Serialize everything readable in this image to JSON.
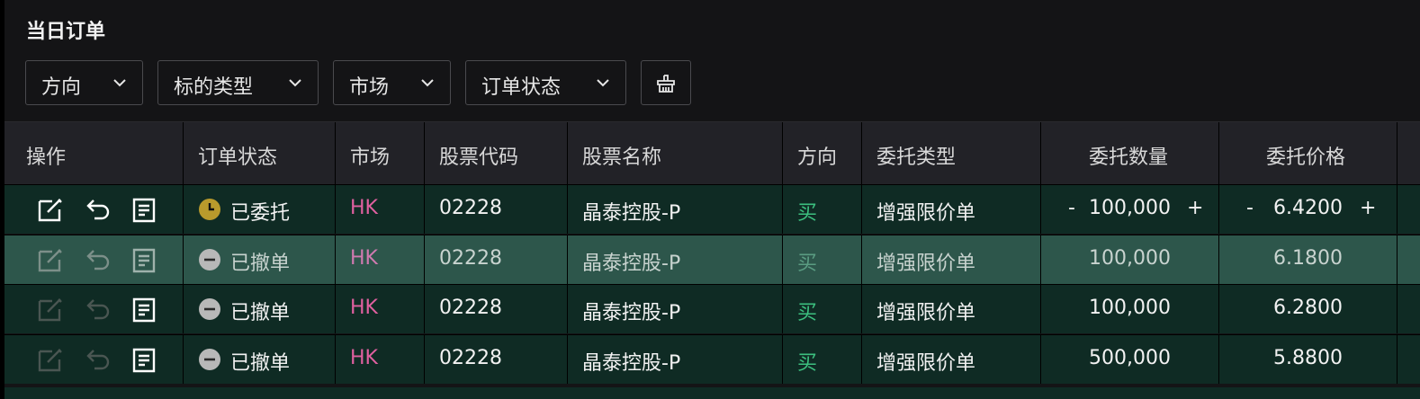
{
  "title": "当日订单",
  "filters": [
    {
      "label": "方向"
    },
    {
      "label": "标的类型"
    },
    {
      "label": "市场"
    },
    {
      "label": "订单状态"
    }
  ],
  "columns": [
    "操作",
    "订单状态",
    "市场",
    "股票代码",
    "股票名称",
    "方向",
    "委托类型",
    "委托数量",
    "委托价格"
  ],
  "rows": [
    {
      "status": "已委托",
      "status_kind": "pending",
      "market": "HK",
      "code": "02228",
      "name": "晶泰控股-P",
      "side": "买",
      "type": "增强限价单",
      "qty": "100,000",
      "price": "6.4200",
      "editable": true,
      "highlight": false
    },
    {
      "status": "已撤单",
      "status_kind": "cancelled",
      "market": "HK",
      "code": "02228",
      "name": "晶泰控股-P",
      "side": "买",
      "type": "增强限价单",
      "qty": "100,000",
      "price": "6.1800",
      "editable": false,
      "highlight": true
    },
    {
      "status": "已撤单",
      "status_kind": "cancelled",
      "market": "HK",
      "code": "02228",
      "name": "晶泰控股-P",
      "side": "买",
      "type": "增强限价单",
      "qty": "100,000",
      "price": "6.2800",
      "editable": false,
      "highlight": false
    },
    {
      "status": "已撤单",
      "status_kind": "cancelled",
      "market": "HK",
      "code": "02228",
      "name": "晶泰控股-P",
      "side": "买",
      "type": "增强限价单",
      "qty": "500,000",
      "price": "5.8800",
      "editable": false,
      "highlight": false
    }
  ],
  "stepper": {
    "minus": "-",
    "plus": "+"
  },
  "colors": {
    "pending": "#b99a2c",
    "cancelled": "#b8b8b8",
    "market": "#e060a0",
    "buy": "#3cbf7f"
  },
  "icons": [
    "chevron-down-icon",
    "clear-filter-icon",
    "edit-icon",
    "undo-icon",
    "detail-icon",
    "clock-icon",
    "minus-circle-icon"
  ]
}
